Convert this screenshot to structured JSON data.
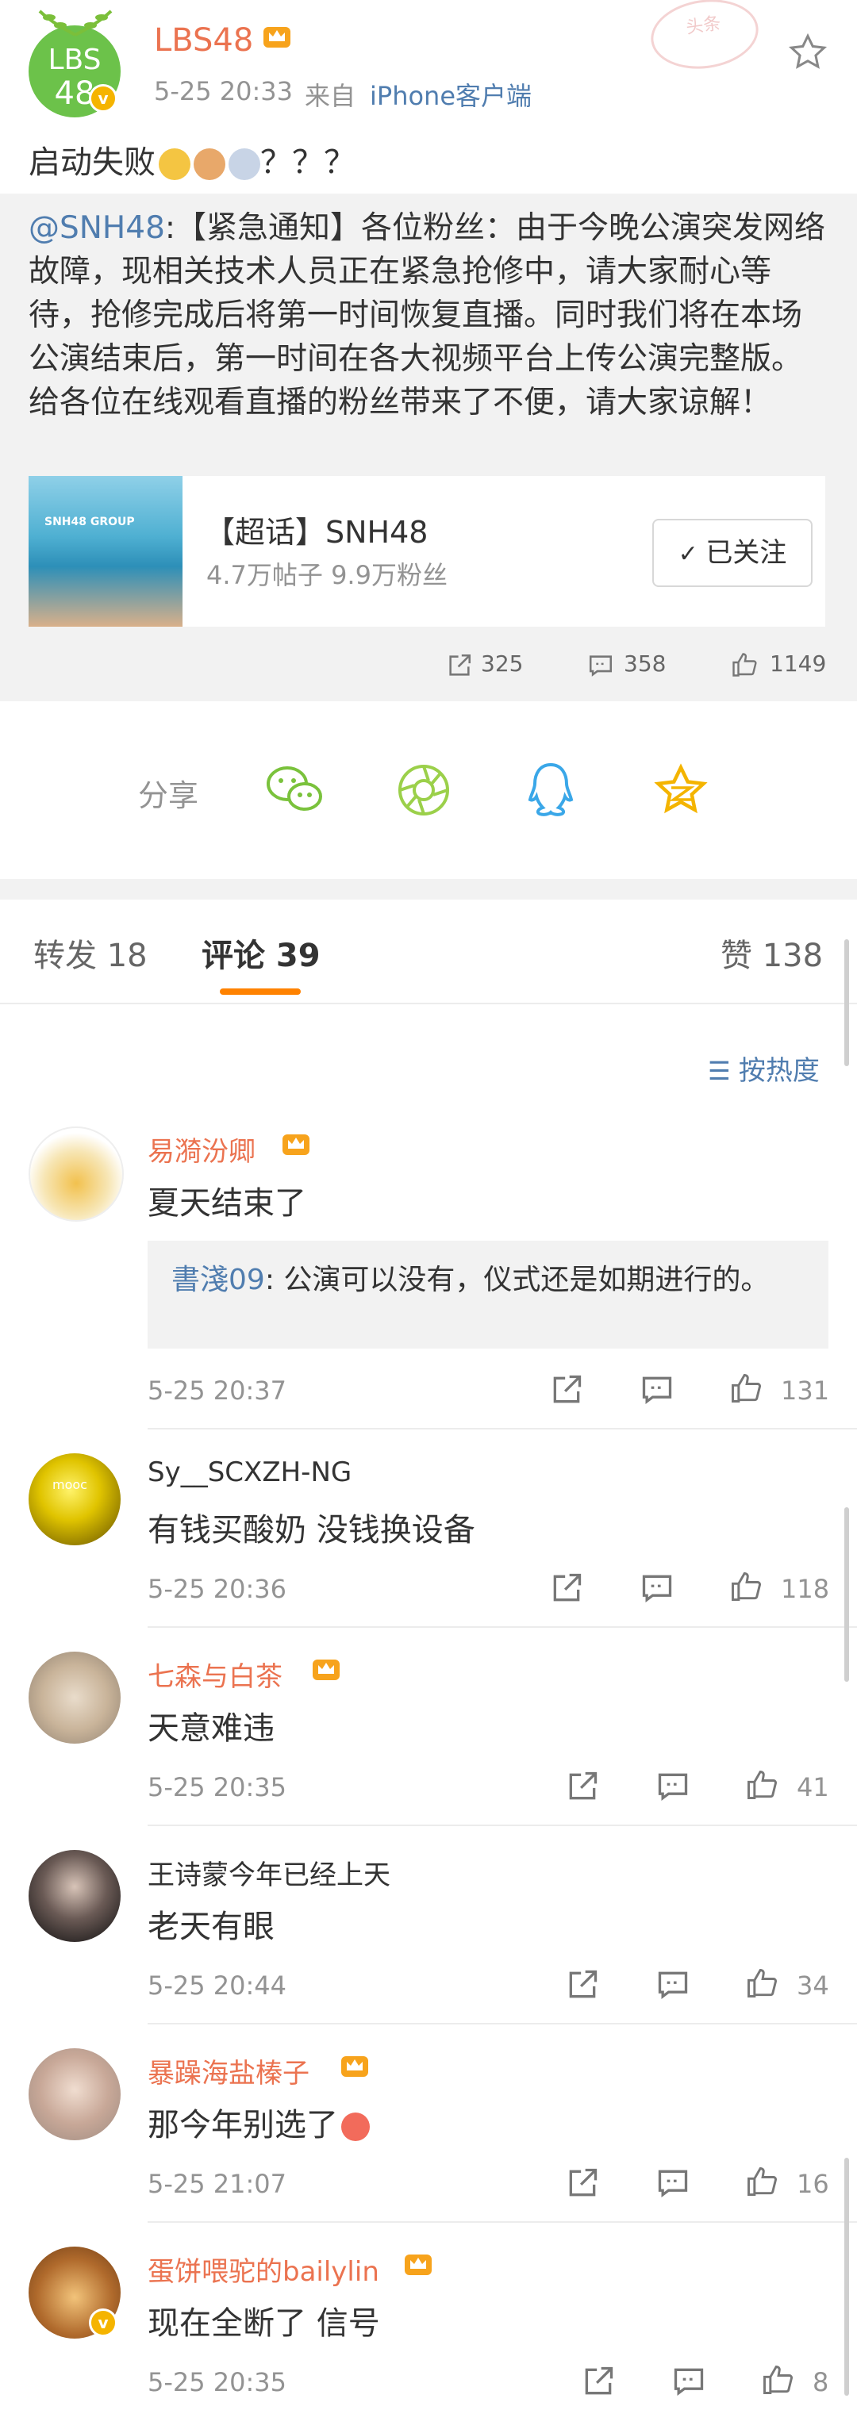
{
  "post": {
    "author": "LBS48",
    "avatar_text_top": "LBS",
    "avatar_text_bottom": "48",
    "time": "5-25 20:33",
    "source_prefix": "来自",
    "source": "iPhone客户端",
    "stamp_text": "头条",
    "text": "启动失败",
    "text_suffix": "？？？",
    "emojis": [
      "dog-emoji",
      "cat-emoji",
      "doge-emoji"
    ]
  },
  "repost": {
    "mention": "@SNH48",
    "content": ":【紧急通知】各位粉丝：由于今晚公演突发网络故障，现相关技术人员正在紧急抢修中，请大家耐心等待，抢修完成后将第一时间恢复直播。同时我们将在本场公演结束后，第一时间在各大视频平台上传公演完整版。给各位在线观看直播的粉丝带来了不便，请大家谅解！",
    "card_image_label": "SNH48 GROUP",
    "card_title": "【超话】SNH48",
    "card_subtitle": "4.7万帖子 9.9万粉丝",
    "follow_label": "已关注",
    "reposts": "325",
    "comments": "358",
    "likes": "1149"
  },
  "share": {
    "label": "分享",
    "icons": [
      "wechat-icon",
      "moments-icon",
      "qq-icon",
      "qzone-icon"
    ]
  },
  "tabs": {
    "repost": "转发 18",
    "comment": "评论 39",
    "like": "赞 138"
  },
  "sort_label": "按热度",
  "comments": [
    {
      "name": "易漪汾卿",
      "vip": true,
      "text": "夏天结束了",
      "time": "5-25 20:37",
      "likes": "131",
      "reply_user": "書淺09",
      "reply_text": ": 公演可以没有，仪式还是如期进行的。"
    },
    {
      "name": "Sy__SCXZH-NG",
      "vip": false,
      "text": "有钱买酸奶 没钱换设备",
      "time": "5-25 20:36",
      "likes": "118",
      "avatar_text": "mooc"
    },
    {
      "name": "七森与白茶",
      "vip": true,
      "text": "天意难违",
      "time": "5-25 20:35",
      "likes": "41"
    },
    {
      "name": "王诗蒙今年已经上天",
      "vip": false,
      "text": "老天有眼",
      "time": "5-25 20:44",
      "likes": "34"
    },
    {
      "name": "暴躁海盐榛子",
      "vip": true,
      "text": "那今年别选了",
      "time": "5-25 21:07",
      "likes": "16"
    },
    {
      "name": "蛋饼喂驼的bailylin",
      "vip": true,
      "text": "现在全断了 信号",
      "time": "5-25 20:35",
      "likes": "8"
    }
  ],
  "colors": {
    "accent_orange": "#eb7350",
    "link_blue": "#507daf",
    "tab_underline": "#ff8200",
    "share_green": "#7ac23c",
    "share_blue": "#3aa7e8",
    "share_yellow": "#f4b400"
  }
}
